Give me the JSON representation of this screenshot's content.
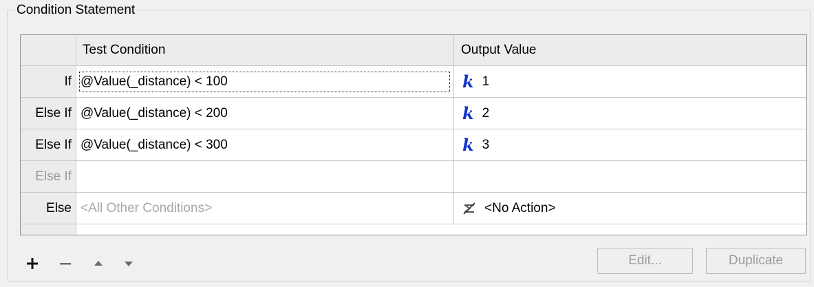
{
  "group": {
    "title": "Condition Statement"
  },
  "table": {
    "headers": {
      "test_condition": "Test Condition",
      "output_value": "Output Value"
    },
    "rows": [
      {
        "label": "If",
        "condition": "@Value(_distance) < 100",
        "output": "1",
        "output_icon": "k-constant-icon"
      },
      {
        "label": "Else If",
        "condition": "@Value(_distance) < 200",
        "output": "2",
        "output_icon": "k-constant-icon"
      },
      {
        "label": "Else If",
        "condition": "@Value(_distance) < 300",
        "output": "3",
        "output_icon": "k-constant-icon"
      },
      {
        "label": "Else If",
        "condition": "",
        "output": ""
      },
      {
        "label": "Else",
        "condition": "<All Other Conditions>",
        "output": "<No Action>",
        "output_icon": "no-action-icon"
      }
    ]
  },
  "icons": {
    "k_glyph": "k"
  },
  "toolbar": {
    "add_icon": "plus-icon",
    "remove_icon": "minus-icon",
    "move_up_icon": "arrow-up-icon",
    "move_down_icon": "arrow-down-icon"
  },
  "buttons": {
    "edit": "Edit...",
    "duplicate": "Duplicate"
  },
  "colors": {
    "k_icon": "#1535c8",
    "disabled_text": "#9c9c9c"
  }
}
